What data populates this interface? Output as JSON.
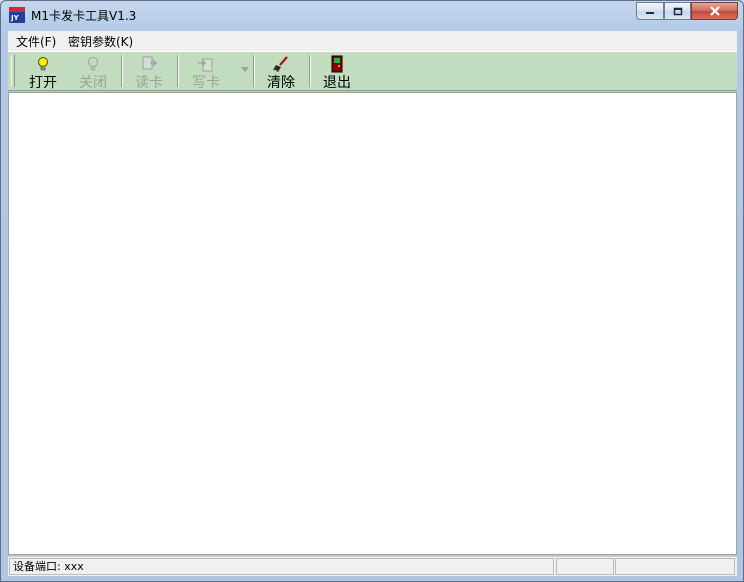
{
  "window": {
    "title": "M1卡发卡工具V1.3",
    "icon": "app-card-icon"
  },
  "menu": {
    "items": [
      {
        "label": "文件(F)"
      },
      {
        "label": "密钥参数(K)"
      }
    ]
  },
  "toolbar": {
    "buttons": [
      {
        "label": "打开",
        "icon": "lightbulb-on-icon",
        "enabled": true
      },
      {
        "label": "关闭",
        "icon": "lightbulb-off-icon",
        "enabled": false
      },
      {
        "label": "读卡",
        "icon": "read-card-icon",
        "enabled": false
      },
      {
        "label": "写卡",
        "icon": "write-card-icon",
        "enabled": false
      },
      {
        "label": "清除",
        "icon": "brush-icon",
        "enabled": true
      },
      {
        "label": "退出",
        "icon": "exit-door-icon",
        "enabled": true
      }
    ]
  },
  "status": {
    "port_label": "设备端口:",
    "port_value": "xxx"
  },
  "colors": {
    "toolbar_bg": "#c2dcbf",
    "disabled_text": "#9aa39a"
  }
}
